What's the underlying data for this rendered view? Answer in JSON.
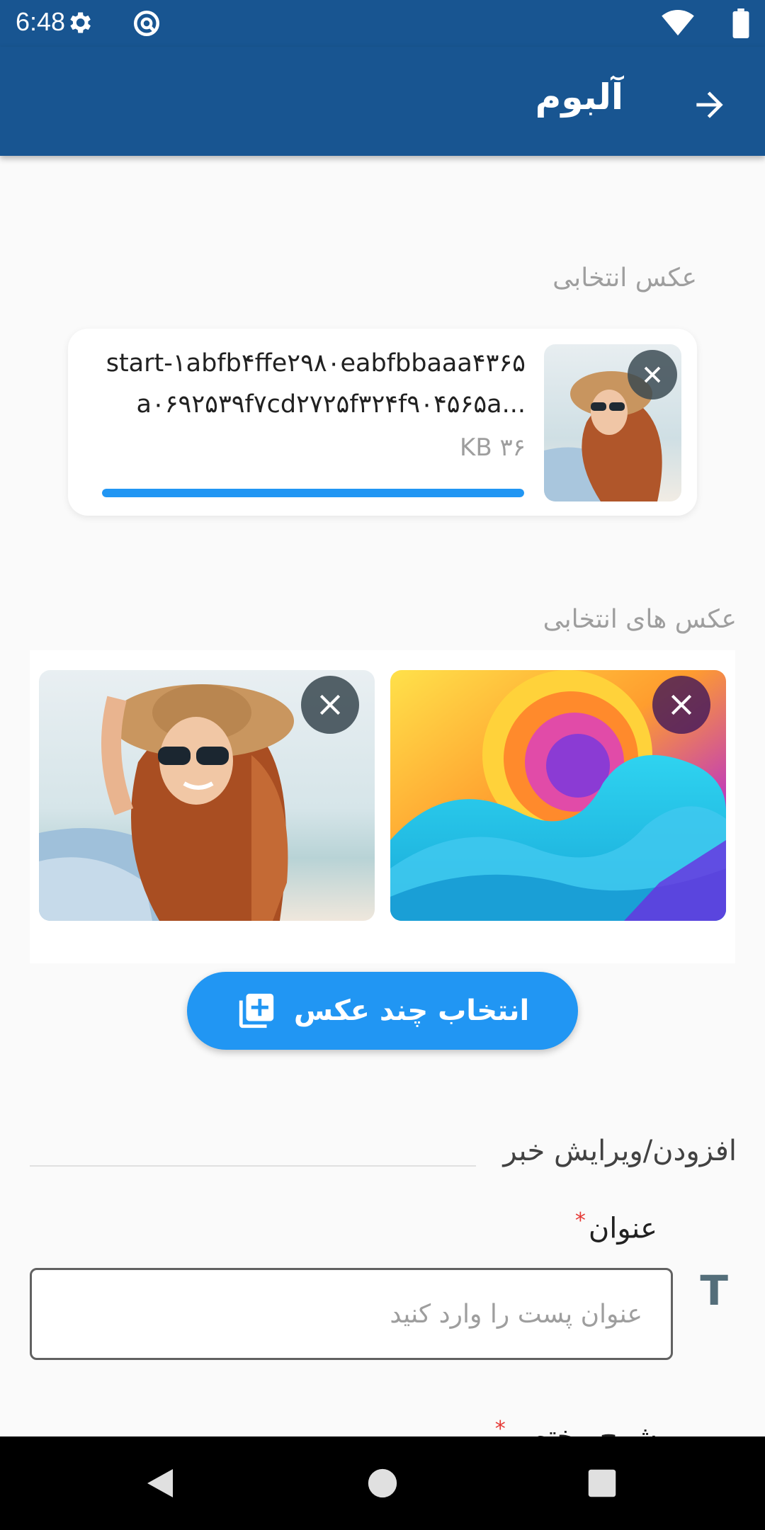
{
  "status_bar": {
    "time": "6:48",
    "icons": [
      "gear-icon",
      "sync-icon",
      "wifi-icon",
      "battery-icon"
    ]
  },
  "app_bar": {
    "title": "آلبوم",
    "back_icon": "arrow-forward-icon"
  },
  "selected_photo": {
    "label": "عکس انتخابی",
    "file_name": "start-۱abfb۴ffe۲۹۸۰eabfbbaaa۴۳۶۵a۰۶۹۲۵۳۹f۷cd۲۷۲۵f۳۲۴f۹۰۴۵۶۵a...",
    "file_size": "KB ۳۶",
    "upload_progress": 1.0
  },
  "selected_photos": {
    "label": "عکس های انتخابی",
    "items": [
      {
        "name": "woman-hat-photo"
      },
      {
        "name": "abstract-swirl-photo"
      }
    ]
  },
  "select_multiple_button": {
    "label": "انتخاب چند عکس",
    "icon": "add-photos-icon"
  },
  "form": {
    "heading": "افزودن/ویرایش خبر",
    "title_field": {
      "label": "عنوان",
      "required_mark": "*",
      "placeholder": "عنوان پست را وارد کنید",
      "value": "",
      "icon": "T"
    },
    "summary_field": {
      "label": "شرح مختصر",
      "required_mark": "*"
    }
  },
  "colors": {
    "app_bar": "#185591",
    "accent": "#2196f3",
    "required": "#e53935"
  }
}
